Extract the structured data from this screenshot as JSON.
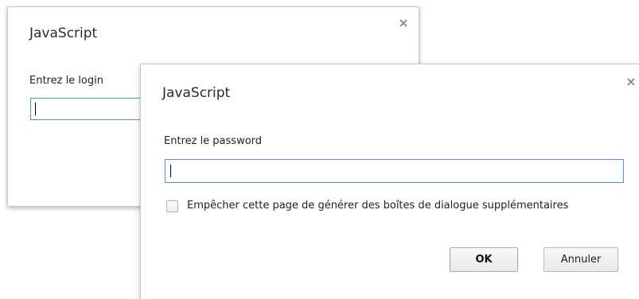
{
  "login_dialog": {
    "title": "JavaScript",
    "prompt_label": "Entrez le login",
    "input_value": "",
    "close_glyph": "×"
  },
  "password_dialog": {
    "title": "JavaScript",
    "prompt_label": "Entrez le password",
    "input_value": "",
    "close_glyph": "×",
    "suppress_checkbox_label": "Empêcher cette page de générer des boîtes de dialogue supplémentaires",
    "suppress_checked": false,
    "ok_label": "OK",
    "cancel_label": "Annuler"
  },
  "colors": {
    "focus_border": "#4d90fe",
    "dialog_border": "#c8c8c8",
    "close_icon": "#8a8a8a"
  },
  "icons": {
    "close": "close-icon"
  }
}
